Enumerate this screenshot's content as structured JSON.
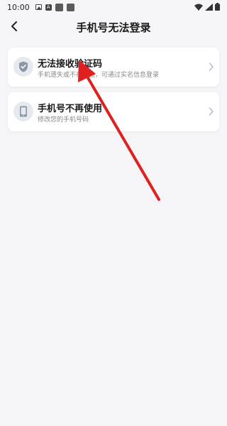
{
  "status_bar": {
    "time": "10:00",
    "icons": [
      "image-icon",
      "a-badge-icon",
      "square-icon",
      "square-icon",
      "wifi-icon",
      "signal-icon",
      "battery-icon"
    ]
  },
  "nav": {
    "title": "手机号无法登录",
    "back_icon": "chevron-left-icon"
  },
  "options": [
    {
      "title": "无法接收验证码",
      "subtitle": "手机遗失或不在身边，可通过实名信息登录",
      "icon": "shield-check-icon"
    },
    {
      "title": "手机号不再使用",
      "subtitle": "修改您的手机号码",
      "icon": "phone-icon"
    }
  ],
  "colors": {
    "background": "#F5F5F7",
    "card": "#FFFFFF",
    "icon_circle": "#E6E9EE",
    "icon_fill": "#8A96A8",
    "annotation_arrow": "#E02020"
  }
}
